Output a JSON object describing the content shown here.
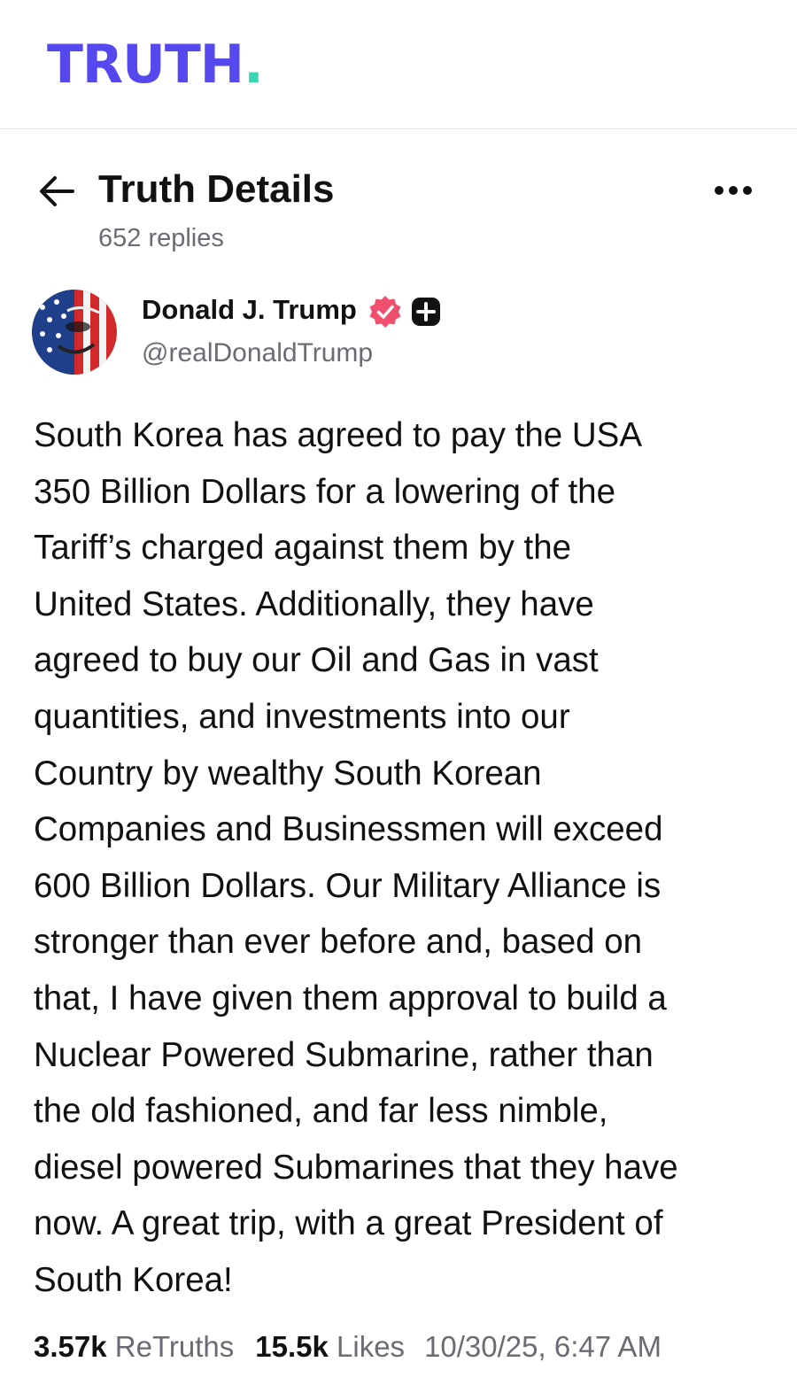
{
  "brand": {
    "logo_text": "TRUTH",
    "logo_dot": ".",
    "primary_color": "#5448ee",
    "accent_color": "#38d6b2"
  },
  "header": {
    "back_icon": "arrow-left-icon",
    "title": "Truth Details",
    "replies": "652 replies",
    "more_icon": "more-horizontal-icon"
  },
  "author": {
    "name": "Donald J. Trump",
    "handle": "@realDonaldTrump",
    "verified_icon": "verified-badge-icon",
    "verified_color": "#f0506e",
    "badge_icon": "plus-badge-icon"
  },
  "post": {
    "text_lines": [
      "South Korea has agreed to pay the USA",
      "350 Billion Dollars for a lowering of the",
      "Tariff’s charged against them by the",
      "United States. Additionally, they have",
      "agreed to buy our Oil and Gas in vast",
      "quantities, and investments into our",
      "Country by wealthy South Korean",
      "Companies and Businessmen will exceed",
      "600 Billion Dollars. Our Military Alliance is",
      "stronger than ever before and, based on",
      "that, I have given them approval to build a",
      "Nuclear Powered Submarine, rather than",
      "the old fashioned, and far less nimble,",
      "diesel powered Submarines that they have",
      "now. A great trip, with a great President of",
      "South Korea!"
    ]
  },
  "stats": {
    "retruths_count": "3.57k",
    "retruths_label": "ReTruths",
    "likes_count": "15.5k",
    "likes_label": "Likes",
    "timestamp": "10/30/25, 6:47 AM"
  }
}
